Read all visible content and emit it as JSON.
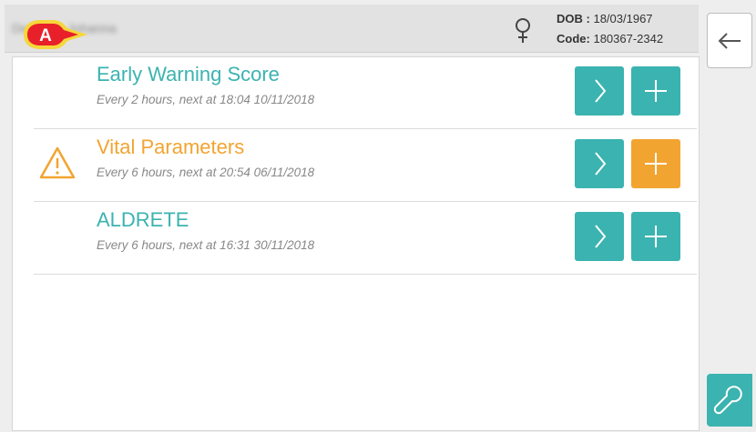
{
  "patient": {
    "name": "De Vries, Johanna",
    "gender_icon": "female-icon",
    "dob_label": "DOB :",
    "dob_value": "18/03/1967",
    "code_label": "Code:",
    "code_value": "180367-2342"
  },
  "marker": {
    "letter": "A",
    "color": "#e8202a",
    "outline": "#f6d63a"
  },
  "rows": [
    {
      "title": "Early Warning Score",
      "subtitle": "Every 2 hours, next at 18:04 10/11/2018",
      "status": "ok",
      "open_icon": "chevron-right-icon",
      "add_icon": "plus-icon",
      "add_color": "#3bb3b0"
    },
    {
      "title": "Vital Parameters",
      "subtitle": "Every 6 hours, next at 20:54 06/11/2018",
      "status": "warning",
      "open_icon": "chevron-right-icon",
      "add_icon": "plus-icon",
      "add_color": "#f2a431"
    },
    {
      "title": "ALDRETE",
      "subtitle": "Every 6 hours, next at 16:31 30/11/2018",
      "status": "ok",
      "open_icon": "chevron-right-icon",
      "add_icon": "plus-icon",
      "add_color": "#3bb3b0"
    }
  ],
  "sidebar": {
    "back_icon": "arrow-left-icon",
    "tools_icon": "wrench-icon"
  },
  "colors": {
    "teal": "#3bb3b0",
    "orange": "#f2a431"
  }
}
